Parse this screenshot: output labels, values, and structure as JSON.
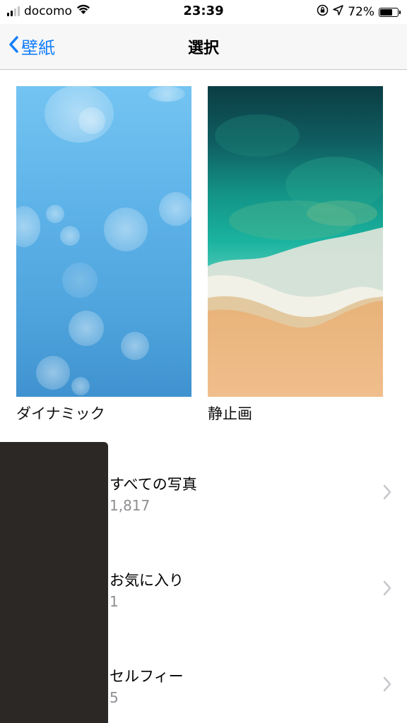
{
  "status_bar": {
    "carrier": "docomo",
    "time": "23:39",
    "battery_percent": "72%",
    "battery_level": 0.72,
    "signal_bars": 2,
    "icons": [
      "signal-icon",
      "wifi-icon",
      "orientation-lock-icon",
      "location-arrow-icon",
      "battery-icon"
    ]
  },
  "nav": {
    "back_label": "壁紙",
    "title": "選択"
  },
  "wallpapers": [
    {
      "label": "ダイナミック"
    },
    {
      "label": "静止画"
    }
  ],
  "albums": [
    {
      "title": "すべての写真",
      "count": "1,817"
    },
    {
      "title": "お気に入り",
      "count": "1"
    },
    {
      "title": "セルフィー",
      "count": "5"
    }
  ],
  "colors": {
    "accent": "#147efb",
    "secondary_text": "#8e8e93",
    "overlay": "#2c2825"
  }
}
